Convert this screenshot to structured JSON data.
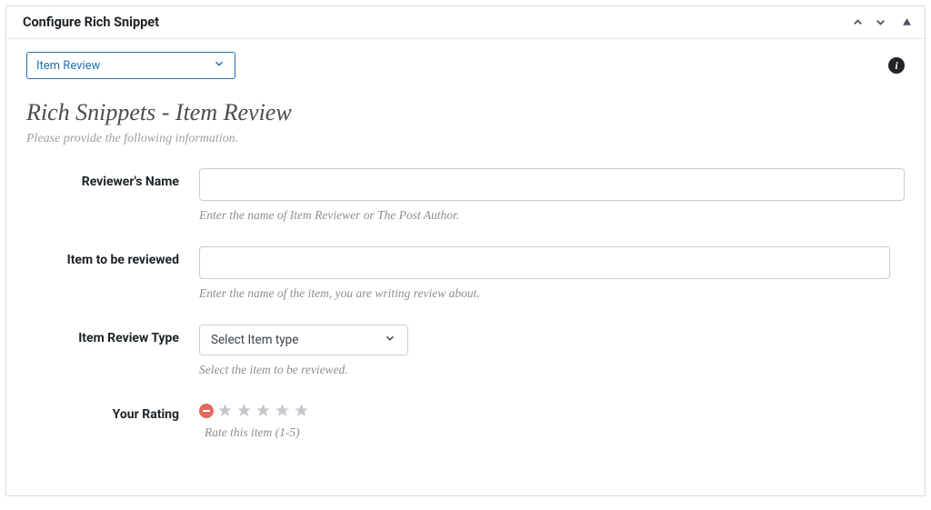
{
  "panel": {
    "title": "Configure Rich Snippet"
  },
  "snippet_type_select": {
    "selected": "Item Review"
  },
  "section": {
    "title": "Rich Snippets - Item Review",
    "subtitle": "Please provide the following information."
  },
  "fields": {
    "reviewer_name": {
      "label": "Reviewer's Name",
      "value": "",
      "helper": "Enter the name of Item Reviewer or The Post Author."
    },
    "item_reviewed": {
      "label": "Item to be reviewed",
      "value": "",
      "helper": "Enter the name of the item, you are writing review about."
    },
    "item_type": {
      "label": "Item Review Type",
      "selected": "Select Item type",
      "helper": "Select the item to be reviewed."
    },
    "rating": {
      "label": "Your Rating",
      "value": 0,
      "max": 5,
      "helper": "Rate this item (1-5)"
    }
  },
  "info_badge_text": "i"
}
